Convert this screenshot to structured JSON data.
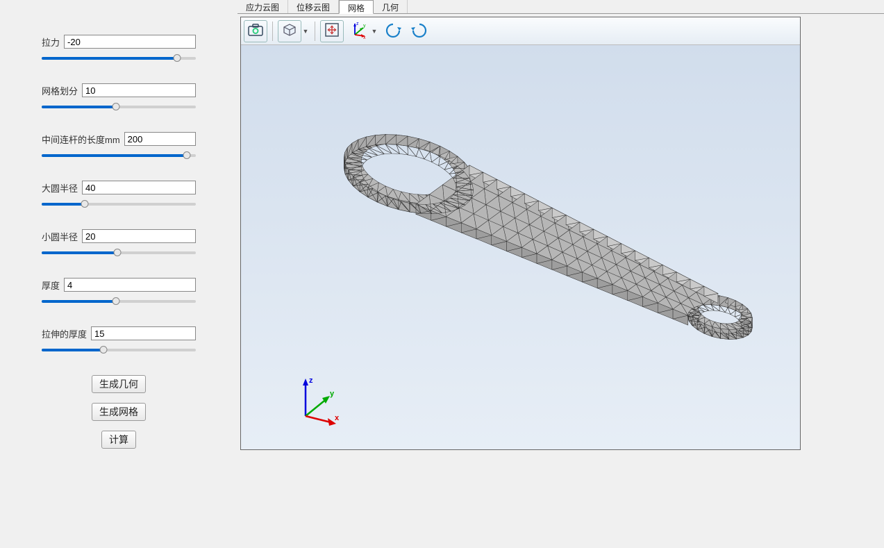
{
  "params": {
    "tension": {
      "label": "拉力",
      "value": "-20",
      "pct": 88
    },
    "mesh": {
      "label": "网格划分",
      "value": "10",
      "pct": 48
    },
    "rod_len": {
      "label": "中间连杆的长度mm",
      "value": "200",
      "pct": 94
    },
    "big_r": {
      "label": "大圆半径",
      "value": "40",
      "pct": 28
    },
    "small_r": {
      "label": "小圆半径",
      "value": "20",
      "pct": 49
    },
    "thickness": {
      "label": "厚度",
      "value": "4",
      "pct": 48
    },
    "extrude": {
      "label": "拉伸的厚度",
      "value": "15",
      "pct": 40
    }
  },
  "buttons": {
    "gen_geom": "生成几何",
    "gen_mesh": "生成网格",
    "calc": "计算"
  },
  "tabs": {
    "stress": "应力云图",
    "disp": "位移云图",
    "mesh": "网格",
    "geom": "几何"
  },
  "triad": {
    "x": "x",
    "y": "y",
    "z": "z"
  },
  "icons": {
    "camera": "camera",
    "cube": "cube",
    "fit": "fit",
    "axes": "axes",
    "rotate_left": "rotate_left",
    "rotate_right": "rotate_right"
  }
}
